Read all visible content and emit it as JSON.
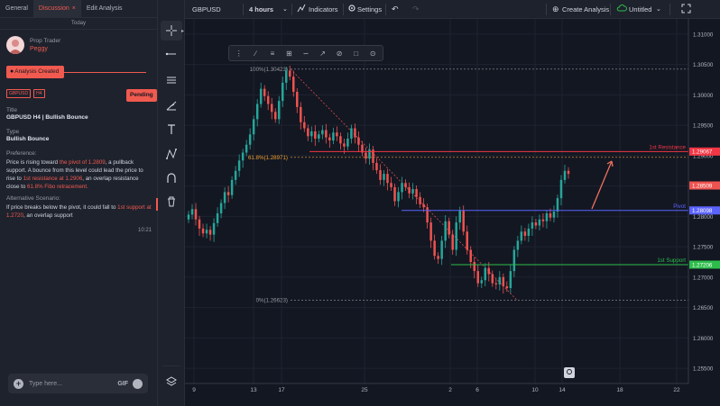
{
  "left_panel": {
    "tabs": [
      "General",
      "Discussion",
      "Edit Analysis"
    ],
    "tab_close": "×",
    "date_separator": "Today",
    "user": {
      "role": "Prop Trader",
      "name": "Peggy"
    },
    "event_label": "Analysis Created",
    "tags": [
      "GBPUSD",
      "H4"
    ],
    "status": "Pending",
    "title_label": "Title",
    "title_value": "GBPUSD H4 | Bullish Bounce",
    "type_label": "Type",
    "type_value": "Bullish Bounce",
    "preference_label": "Preference:",
    "preference_parts": [
      "Price is rising toward ",
      "the pivot of 1.2809",
      ", a pullback support. A bounce from this level could lead the price to rise to ",
      "1st resistance at 1.2906",
      ", an overlap resistance close to ",
      "61.8% Fibo retracement."
    ],
    "alt_label": "Alternative Scenario:",
    "alt_parts": [
      "If price breaks below the pivot, it could fall to ",
      "1st support at 1.2720",
      ", an overlap support"
    ],
    "timestamp": "10:21",
    "message_placeholder": "Type here...",
    "gif_label": "GIF"
  },
  "topbar": {
    "symbol": "GBPUSD",
    "interval": "4 hours",
    "indicators": "Indicators",
    "settings": "Settings",
    "create": "Create Analysis",
    "layout_name": "Untitled"
  },
  "chart_data": {
    "type": "candlestick",
    "x_ticks": [
      "9",
      "13",
      "17",
      "25",
      "2",
      "6",
      "10",
      "14",
      "18",
      "22"
    ],
    "y_ticks": [
      "1.31000",
      "1.30500",
      "1.30000",
      "1.29500",
      "1.29000",
      "1.28500",
      "1.28000",
      "1.27500",
      "1.27000",
      "1.26500",
      "1.26000",
      "1.25500"
    ],
    "ylim": [
      1.2525,
      1.3125
    ],
    "last_price": "1.28509",
    "levels": [
      {
        "name": "1st Resistance",
        "value": 1.29067,
        "label": "1.29067",
        "color": "#f23645"
      },
      {
        "name": "Pivot",
        "value": 1.28098,
        "label": "1.28098",
        "color": "#5b63ff"
      },
      {
        "name": "1st Support",
        "value": 1.27206,
        "label": "1.27206",
        "color": "#2dbd4b"
      }
    ],
    "fib": [
      {
        "label": "100%(1.30423)",
        "value": 1.30423
      },
      {
        "label": "61.8%(1.28971)",
        "value": 1.28971
      },
      {
        "label": "0%(1.26623)",
        "value": 1.26623
      }
    ],
    "closes": [
      1.2803,
      1.2812,
      1.2795,
      1.278,
      1.2772,
      1.2778,
      1.277,
      1.2789,
      1.2805,
      1.2822,
      1.284,
      1.2835,
      1.286,
      1.2875,
      1.2892,
      1.2905,
      1.2918,
      1.2935,
      1.296,
      1.2985,
      1.301,
      1.2998,
      1.2985,
      1.2972,
      1.296,
      1.299,
      1.302,
      1.304,
      1.303,
      1.3005,
      1.298,
      1.2955,
      1.2945,
      1.2932,
      1.294,
      1.2928,
      1.2935,
      1.2942,
      1.293,
      1.2925,
      1.2938,
      1.2932,
      1.292,
      1.2915,
      1.2928,
      1.2945,
      1.293,
      1.2918,
      1.2905,
      1.2895,
      1.291,
      1.2888,
      1.2876,
      1.286,
      1.287,
      1.2855,
      1.2848,
      1.2825,
      1.284,
      1.2855,
      1.2848,
      1.2838,
      1.2845,
      1.2832,
      1.282,
      1.2815,
      1.279,
      1.276,
      1.2735,
      1.273,
      1.276,
      1.2792,
      1.277,
      1.2745,
      1.279,
      1.281,
      1.2775,
      1.2745,
      1.2725,
      1.271,
      1.269,
      1.2695,
      1.2715,
      1.2705,
      1.269,
      1.2688,
      1.27,
      1.2685,
      1.2682,
      1.271,
      1.2745,
      1.276,
      1.2775,
      1.2768,
      1.278,
      1.279,
      1.2785,
      1.2795,
      1.2792,
      1.2805,
      1.2798,
      1.2808,
      1.283,
      1.286,
      1.2875,
      1.287
    ]
  }
}
